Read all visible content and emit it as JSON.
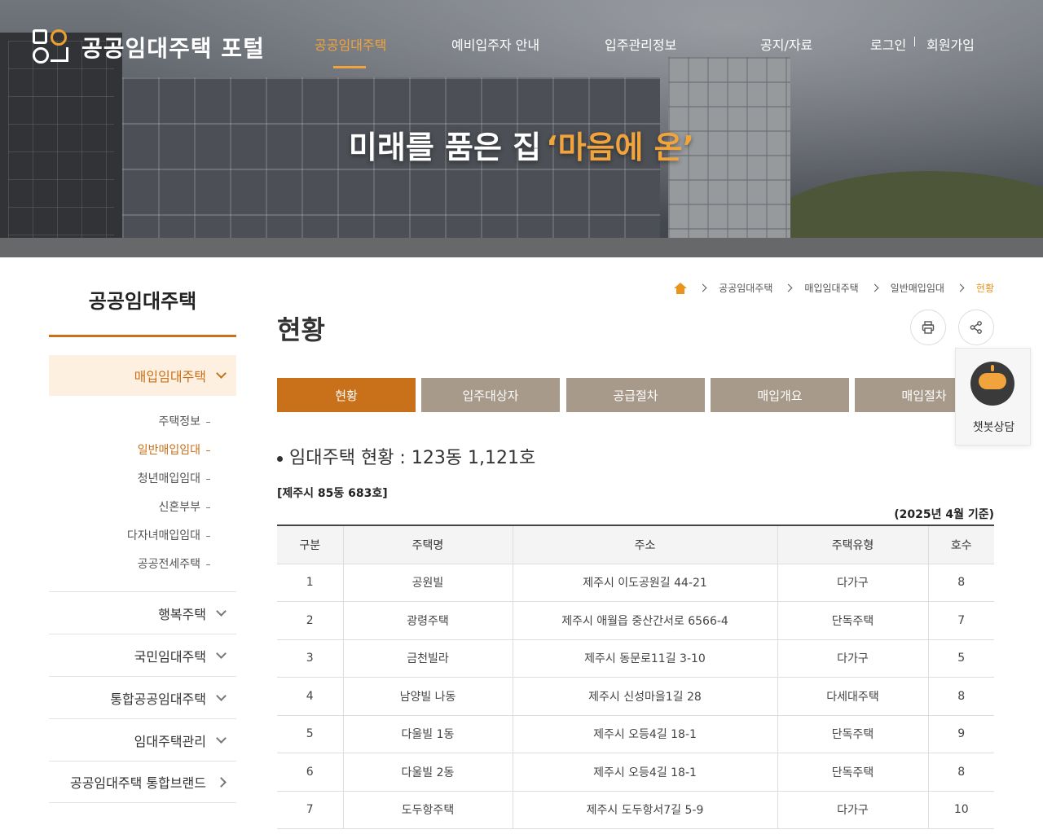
{
  "header": {
    "logo_text": "공공임대주택 포털",
    "nav": [
      {
        "label": "공공임대주택",
        "active": true
      },
      {
        "label": "예비입주자 안내",
        "active": false
      },
      {
        "label": "입주관리정보",
        "active": false
      },
      {
        "label": "공지/자료",
        "active": false
      }
    ],
    "login": "로그인",
    "signup": "회원가입",
    "slogan_main": "미래를 품은 집",
    "slogan_highlight": "‘마음에 온’",
    "accent_color": "#f2a43c"
  },
  "sidebar": {
    "title": "공공임대주택",
    "open_menu": "매입임대주택",
    "sub_items": [
      {
        "label": "주택정보",
        "active": false
      },
      {
        "label": "일반매입임대",
        "active": true
      },
      {
        "label": "청년매입임대",
        "active": false
      },
      {
        "label": "신혼부부",
        "active": false
      },
      {
        "label": "다자녀매입임대",
        "active": false
      },
      {
        "label": "공공전세주택",
        "active": false
      }
    ],
    "menus": [
      {
        "label": "행복주택",
        "icon": "chevron-down-icon"
      },
      {
        "label": "국민임대주택",
        "icon": "chevron-down-icon"
      },
      {
        "label": "통합공공임대주택",
        "icon": "chevron-down-icon"
      },
      {
        "label": "임대주택관리",
        "icon": "chevron-down-icon"
      },
      {
        "label": "공공임대주택 통합브랜드",
        "icon": "chevron-right-icon"
      }
    ],
    "accent_color": "#c9701a"
  },
  "breadcrumb": [
    "공공임대주택",
    "매입임대주택",
    "일반매입임대",
    "현황"
  ],
  "page": {
    "title": "현황",
    "tools": {
      "print_icon": "print-icon",
      "share_icon": "share-icon"
    }
  },
  "tabs": [
    {
      "label": "현황",
      "active": true
    },
    {
      "label": "입주대상자",
      "active": false
    },
    {
      "label": "공급절차",
      "active": false
    },
    {
      "label": "매입개요",
      "active": false
    },
    {
      "label": "매입절차",
      "active": false
    }
  ],
  "chatbot": {
    "label": "챗봇상담",
    "icon": "robot-icon"
  },
  "content": {
    "section_title": "임대주택 현황 : 123동 1,121호",
    "sub_title": "[제주시 85동 683호]",
    "basis": "(2025년 4월 기준)",
    "table": {
      "headers": [
        "구분",
        "주택명",
        "주소",
        "주택유형",
        "호수"
      ],
      "rows": [
        [
          "1",
          "공원빌",
          "제주시 이도공원길 44-21",
          "다가구",
          "8"
        ],
        [
          "2",
          "광령주택",
          "제주시 애월읍 중산간서로 6566-4",
          "단독주택",
          "7"
        ],
        [
          "3",
          "금천빌라",
          "제주시 동문로11길 3-10",
          "다가구",
          "5"
        ],
        [
          "4",
          "남양빌 나동",
          "제주시 신성마을1길 28",
          "다세대주택",
          "8"
        ],
        [
          "5",
          "다울빌 1동",
          "제주시 오등4길 18-1",
          "단독주택",
          "9"
        ],
        [
          "6",
          "다울빌 2동",
          "제주시 오등4길 18-1",
          "단독주택",
          "8"
        ],
        [
          "7",
          "도두항주택",
          "제주시 도두항서7길 5-9",
          "다가구",
          "10"
        ]
      ]
    }
  }
}
